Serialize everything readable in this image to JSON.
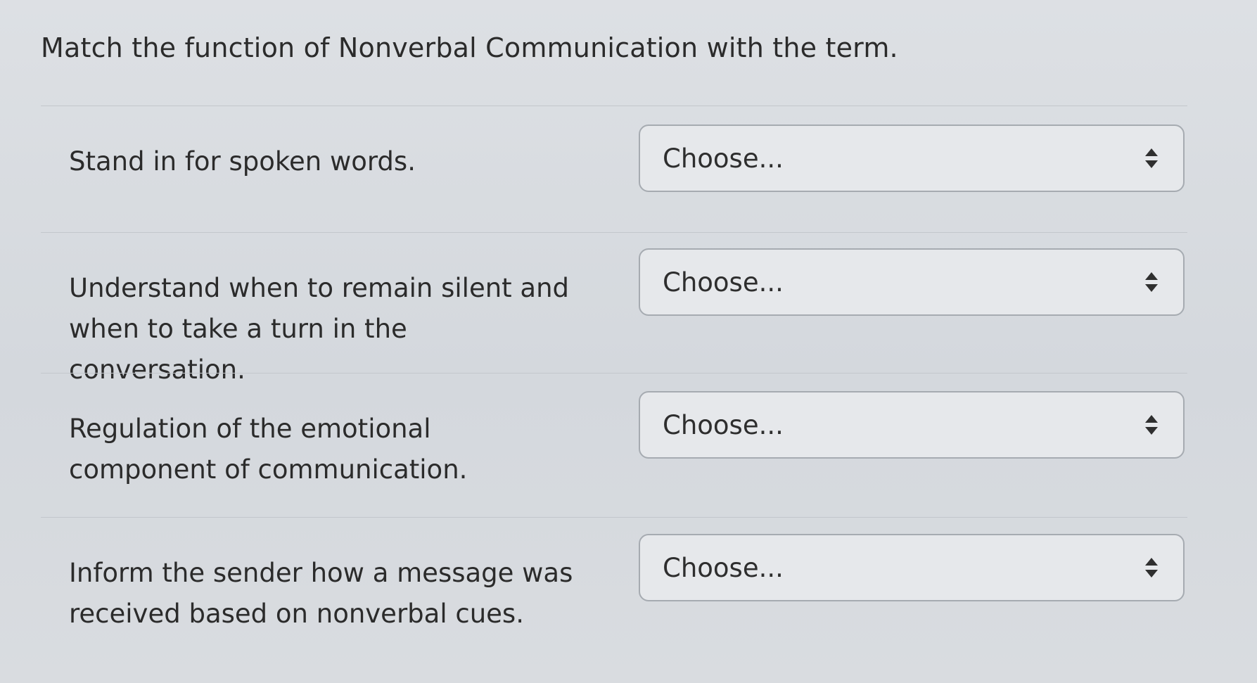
{
  "question": {
    "title": "Match the function of Nonverbal Communication with the term."
  },
  "rows": [
    {
      "label": "Stand in for spoken words.",
      "select_value": "Choose..."
    },
    {
      "label": "Understand when to remain silent and when to take a turn in the conversation.",
      "select_value": "Choose..."
    },
    {
      "label": "Regulation of the emotional component of communication.",
      "select_value": "Choose..."
    },
    {
      "label": "Inform the sender how a message was received based on nonverbal cues.",
      "select_value": "Choose..."
    }
  ],
  "icons": {
    "select_arrows": "up-down-caret-icon"
  },
  "colors": {
    "page_bg": "#d9dde2",
    "select_border": "#a6abb1",
    "select_bg": "#e6e8eb",
    "text": "#2b2b2b"
  }
}
